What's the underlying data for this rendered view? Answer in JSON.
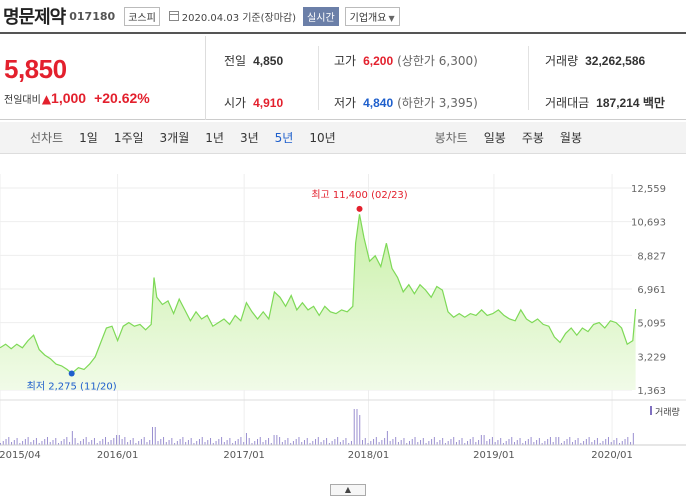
{
  "header": {
    "stock_name": "명문제약",
    "stock_code": "017180",
    "market": "코스피",
    "date_text": "2020.04.03 기준(장마감)",
    "realtime_label": "실시간",
    "company_info_label": "기업개요"
  },
  "price": {
    "current": "5,850",
    "change_label": "전일대비",
    "change_arrow": "▲",
    "change_value": "1,000",
    "change_pct": "+20.62%"
  },
  "stats": {
    "prev_close_label": "전일",
    "prev_close": "4,850",
    "high_label": "고가",
    "high": "6,200",
    "upper_limit": "(상한가 6,300)",
    "volume_label": "거래량",
    "volume": "32,262,586",
    "open_label": "시가",
    "open": "4,910",
    "low_label": "저가",
    "low": "4,840",
    "lower_limit": "(하한가 3,395)",
    "amount_label": "거래대금",
    "amount": "187,214 백만"
  },
  "periods": {
    "line_label": "선차트",
    "items": [
      "1일",
      "1주일",
      "3개월",
      "1년",
      "3년",
      "5년",
      "10년"
    ],
    "active": "5년",
    "candle_label": "봉차트",
    "candle_items": [
      "일봉",
      "주봉",
      "월봉"
    ]
  },
  "chart_data": {
    "type": "area",
    "y_ticks": [
      "12,559",
      "10,693",
      "8,827",
      "6,961",
      "5,095",
      "3,229",
      "1,363"
    ],
    "ylim": [
      1363,
      12559
    ],
    "x_ticks": [
      "2015/04",
      "2016/01",
      "2017/01",
      "2018/01",
      "2019/01",
      "2020/01"
    ],
    "x_tick_pos": [
      0.0,
      0.21,
      0.436,
      0.658,
      0.882,
      1.093
    ],
    "max_label": "최고 11,400 (02/23)",
    "max_point": {
      "x": 0.642,
      "y": 11400
    },
    "min_label": "최저 2,275 (11/20)",
    "min_point": {
      "x": 0.128,
      "y": 2275
    },
    "volume_legend": "거래량",
    "series": [
      {
        "values": [
          [
            0.0,
            3700
          ],
          [
            0.01,
            3900
          ],
          [
            0.02,
            3650
          ],
          [
            0.03,
            3900
          ],
          [
            0.04,
            3700
          ],
          [
            0.05,
            4100
          ],
          [
            0.06,
            4400
          ],
          [
            0.07,
            3600
          ],
          [
            0.08,
            3300
          ],
          [
            0.09,
            3100
          ],
          [
            0.1,
            2800
          ],
          [
            0.11,
            2700
          ],
          [
            0.12,
            2500
          ],
          [
            0.128,
            2275
          ],
          [
            0.14,
            2600
          ],
          [
            0.15,
            2500
          ],
          [
            0.16,
            2800
          ],
          [
            0.17,
            3200
          ],
          [
            0.18,
            4000
          ],
          [
            0.19,
            4800
          ],
          [
            0.2,
            4900
          ],
          [
            0.21,
            4100
          ],
          [
            0.22,
            4900
          ],
          [
            0.23,
            5100
          ],
          [
            0.24,
            4900
          ],
          [
            0.25,
            5000
          ],
          [
            0.26,
            4700
          ],
          [
            0.27,
            5000
          ],
          [
            0.275,
            7600
          ],
          [
            0.28,
            6500
          ],
          [
            0.29,
            6100
          ],
          [
            0.3,
            6300
          ],
          [
            0.31,
            5600
          ],
          [
            0.32,
            6400
          ],
          [
            0.33,
            5800
          ],
          [
            0.34,
            5200
          ],
          [
            0.35,
            5700
          ],
          [
            0.36,
            5300
          ],
          [
            0.37,
            5500
          ],
          [
            0.38,
            4900
          ],
          [
            0.39,
            5100
          ],
          [
            0.4,
            5300
          ],
          [
            0.41,
            5000
          ],
          [
            0.42,
            5500
          ],
          [
            0.43,
            5200
          ],
          [
            0.44,
            6200
          ],
          [
            0.45,
            5700
          ],
          [
            0.46,
            5300
          ],
          [
            0.47,
            5700
          ],
          [
            0.48,
            5300
          ],
          [
            0.49,
            6800
          ],
          [
            0.5,
            6500
          ],
          [
            0.51,
            6000
          ],
          [
            0.52,
            6600
          ],
          [
            0.53,
            5800
          ],
          [
            0.54,
            6200
          ],
          [
            0.55,
            5800
          ],
          [
            0.56,
            6000
          ],
          [
            0.57,
            5500
          ],
          [
            0.58,
            6000
          ],
          [
            0.59,
            5700
          ],
          [
            0.6,
            5600
          ],
          [
            0.61,
            5800
          ],
          [
            0.62,
            5700
          ],
          [
            0.63,
            6000
          ],
          [
            0.635,
            9500
          ],
          [
            0.642,
            11100
          ],
          [
            0.65,
            9800
          ],
          [
            0.66,
            8500
          ],
          [
            0.67,
            8800
          ],
          [
            0.68,
            8200
          ],
          [
            0.69,
            9500
          ],
          [
            0.7,
            8100
          ],
          [
            0.71,
            7600
          ],
          [
            0.72,
            6800
          ],
          [
            0.73,
            7200
          ],
          [
            0.74,
            6700
          ],
          [
            0.75,
            7200
          ],
          [
            0.76,
            6900
          ],
          [
            0.77,
            6500
          ],
          [
            0.78,
            7100
          ],
          [
            0.79,
            6900
          ],
          [
            0.8,
            5700
          ],
          [
            0.81,
            5400
          ],
          [
            0.82,
            5600
          ],
          [
            0.83,
            5400
          ],
          [
            0.84,
            5600
          ],
          [
            0.85,
            5500
          ],
          [
            0.86,
            5800
          ],
          [
            0.87,
            5500
          ],
          [
            0.88,
            5600
          ],
          [
            0.89,
            5800
          ],
          [
            0.9,
            5500
          ],
          [
            0.91,
            5300
          ],
          [
            0.92,
            5200
          ],
          [
            0.93,
            5800
          ],
          [
            0.94,
            5300
          ],
          [
            0.95,
            5100
          ],
          [
            0.96,
            5300
          ],
          [
            0.97,
            5000
          ],
          [
            0.98,
            4900
          ],
          [
            0.99,
            4300
          ],
          [
            1.0,
            4000
          ],
          [
            1.01,
            4500
          ],
          [
            1.02,
            4800
          ],
          [
            1.03,
            4400
          ],
          [
            1.04,
            4800
          ],
          [
            1.05,
            4600
          ],
          [
            1.06,
            5000
          ],
          [
            1.07,
            5100
          ],
          [
            1.08,
            4800
          ],
          [
            1.09,
            5200
          ],
          [
            1.1,
            5100
          ],
          [
            1.11,
            4800
          ],
          [
            1.12,
            3900
          ],
          [
            1.13,
            4100
          ],
          [
            1.135,
            5850
          ]
        ]
      }
    ]
  }
}
